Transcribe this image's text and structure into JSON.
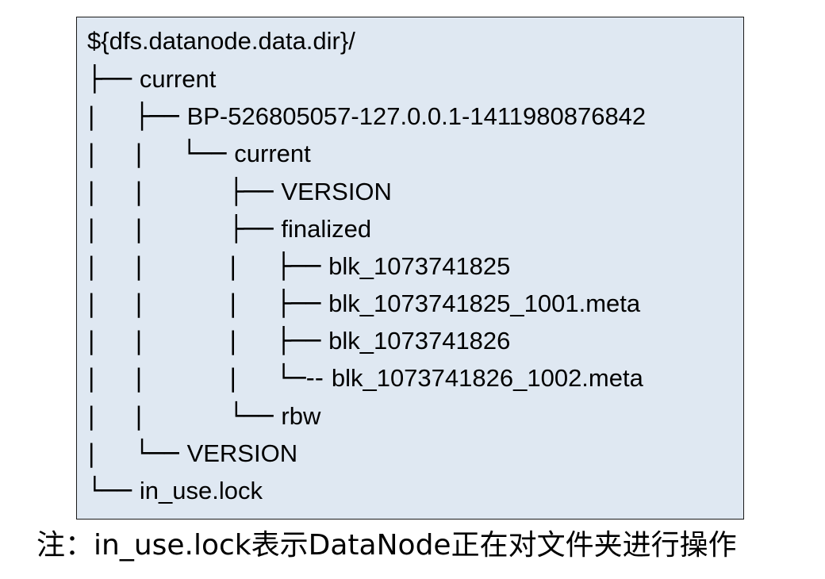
{
  "colors": {
    "panel_background": "#dfe8f2",
    "panel_border": "#1a1a1a",
    "text": "#000000"
  },
  "tree": {
    "root": "${dfs.datanode.data.dir}/",
    "lines": [
      {
        "prefix": "├── ",
        "name": "current"
      },
      {
        "prefix": "|     ├── ",
        "name": "BP-526805057-127.0.0.1-1411980876842"
      },
      {
        "prefix": "|     |     └── ",
        "name": "current"
      },
      {
        "prefix": "|     |           ├── ",
        "name": "VERSION"
      },
      {
        "prefix": "|     |           ├── ",
        "name": "finalized"
      },
      {
        "prefix": "|     |           |     ├── ",
        "name": "blk_1073741825"
      },
      {
        "prefix": "|     |           |     ├── ",
        "name": "blk_1073741825_1001.meta"
      },
      {
        "prefix": "|     |           |     ├── ",
        "name": "blk_1073741826"
      },
      {
        "prefix": "|     |           |     └─-- ",
        "name": "blk_1073741826_1002.meta"
      },
      {
        "prefix": "|     |           └── ",
        "name": "rbw"
      },
      {
        "prefix": "|     └── ",
        "name": "VERSION"
      },
      {
        "prefix": "└── ",
        "name": "in_use.lock"
      }
    ]
  },
  "note": "注：in_use.lock表示DataNode正在对文件夹进行操作"
}
